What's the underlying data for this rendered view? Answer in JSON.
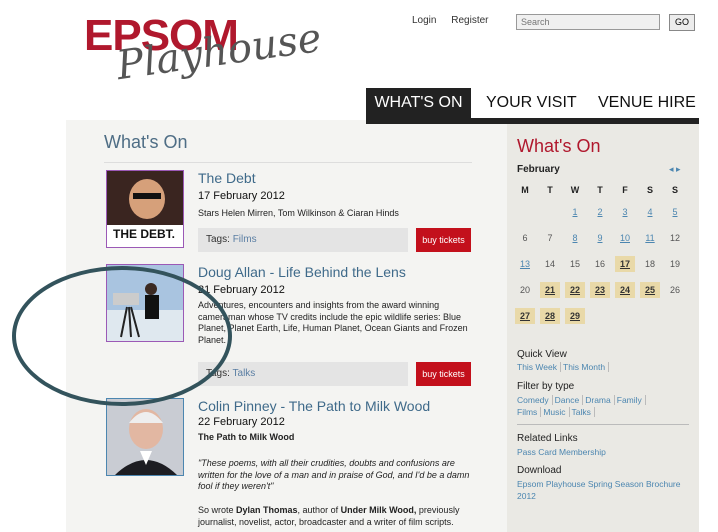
{
  "header": {
    "logo_epsom": "EPSOM",
    "logo_playhouse": "Playhouse",
    "login": "Login",
    "register": "Register",
    "search_placeholder": "Search",
    "go": "GO"
  },
  "nav": [
    "WHAT'S ON",
    "YOUR VISIT",
    "VENUE HIRE"
  ],
  "main": {
    "title": "What's On",
    "events": [
      {
        "title": "The Debt",
        "date": "17 February 2012",
        "desc": "Stars Helen Mirren, Tom Wilkinson & Ciaran Hinds",
        "tags_label": "Tags:",
        "tag": "Films",
        "buy": "buy tickets",
        "thumb_text": "THE DEBT."
      },
      {
        "title": "Doug Allan - Life Behind the Lens",
        "date": "21 February 2012",
        "desc": "Adventures, encounters and insights from the award winning cameraman whose TV credits include the epic wildlife series: Blue Planet, Planet Earth, Life, Human Planet, Ocean Giants and Frozen Planet.",
        "tags_label": "Tags:",
        "tag": "Talks",
        "buy": "buy tickets"
      },
      {
        "title": "Colin Pinney - The Path to Milk Wood",
        "date": "22 February 2012",
        "subtitle": "The Path to Milk Wood",
        "quote": "\"These poems, with all their crudities, doubts and confusions are written for the love of a man and in praise of God, and I'd be a damn fool if they weren't\"",
        "body_prefix": "So wrote ",
        "body_bold1": "Dylan Thomas",
        "body_mid": ", author of ",
        "body_bold2": "Under Milk Wood,",
        "body_suffix": " previously journalist, novelist, actor, broadcaster and a writer of film scripts."
      }
    ]
  },
  "sidebar": {
    "title": "What's On",
    "month": "February",
    "arrows": "◂ ▸",
    "weekdays": [
      "M",
      "T",
      "W",
      "T",
      "F",
      "S",
      "S"
    ],
    "weeks": [
      [
        {
          "d": ""
        },
        {
          "d": ""
        },
        {
          "d": "1",
          "s": "link"
        },
        {
          "d": "2",
          "s": "link"
        },
        {
          "d": "3",
          "s": "link"
        },
        {
          "d": "4",
          "s": "link"
        },
        {
          "d": "5",
          "s": "link"
        }
      ],
      [
        {
          "d": "6"
        },
        {
          "d": "7"
        },
        {
          "d": "8",
          "s": "link"
        },
        {
          "d": "9",
          "s": "link"
        },
        {
          "d": "10",
          "s": "link"
        },
        {
          "d": "11",
          "s": "link"
        },
        {
          "d": "12"
        }
      ],
      [
        {
          "d": "13",
          "s": "link"
        },
        {
          "d": "14"
        },
        {
          "d": "15"
        },
        {
          "d": "16"
        },
        {
          "d": "17",
          "s": "hi"
        },
        {
          "d": "18"
        },
        {
          "d": "19"
        }
      ],
      [
        {
          "d": "20"
        },
        {
          "d": "21",
          "s": "hi"
        },
        {
          "d": "22",
          "s": "hi"
        },
        {
          "d": "23",
          "s": "hi"
        },
        {
          "d": "24",
          "s": "hi"
        },
        {
          "d": "25",
          "s": "hi"
        },
        {
          "d": "26"
        }
      ],
      [
        {
          "d": "27",
          "s": "hi"
        },
        {
          "d": "28",
          "s": "hi"
        },
        {
          "d": "29",
          "s": "hi"
        },
        {
          "d": ""
        },
        {
          "d": ""
        },
        {
          "d": ""
        },
        {
          "d": ""
        }
      ]
    ],
    "quick_view_title": "Quick View",
    "quick_view_links": [
      "This Week",
      "This Month"
    ],
    "filter_title": "Filter by type",
    "filter_links": [
      "Comedy",
      "Dance",
      "Drama",
      "Family",
      "Films",
      "Music",
      "Talks"
    ],
    "related_title": "Related Links",
    "related_links": [
      "Pass Card Membership"
    ],
    "download_title": "Download",
    "download_links": [
      "Epsom Playhouse Spring Season Brochure 2012"
    ]
  }
}
